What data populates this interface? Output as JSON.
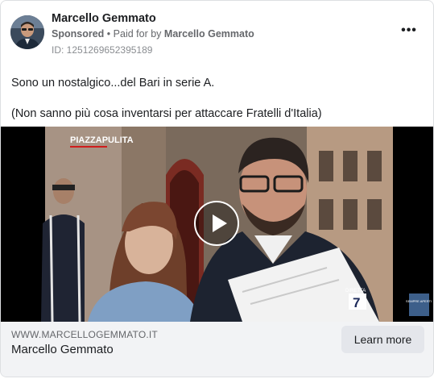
{
  "post": {
    "page_name": "Marcello Gemmato",
    "sponsored_label": "Sponsored",
    "separator": "•",
    "paid_for_prefix": "Paid for by",
    "paid_for_name": "Marcello Gemmato",
    "ad_id": "ID: 1251269652395189",
    "more_icon": "more-options-icon",
    "text_lines": [
      "Sono un nostalgico...del Bari in serie A.",
      "(Non sanno più cosa inventarsi per attaccare Fratelli d'Italia)"
    ]
  },
  "video": {
    "watermark_top_left": "PIAZZAPULITA",
    "channel_logo_label": "DIRETTA",
    "channel_logo_number": "7",
    "corner_badge": "SEMPRE APERTI",
    "play_icon": "play-icon"
  },
  "link_preview": {
    "domain": "WWW.MARCELLOGEMMATO.IT",
    "headline": "Marcello Gemmato",
    "cta_label": "Learn more"
  },
  "colors": {
    "text_primary": "#1c1e21",
    "text_secondary": "#65676b",
    "footer_bg": "#f2f3f5",
    "button_bg": "#e4e6eb"
  }
}
